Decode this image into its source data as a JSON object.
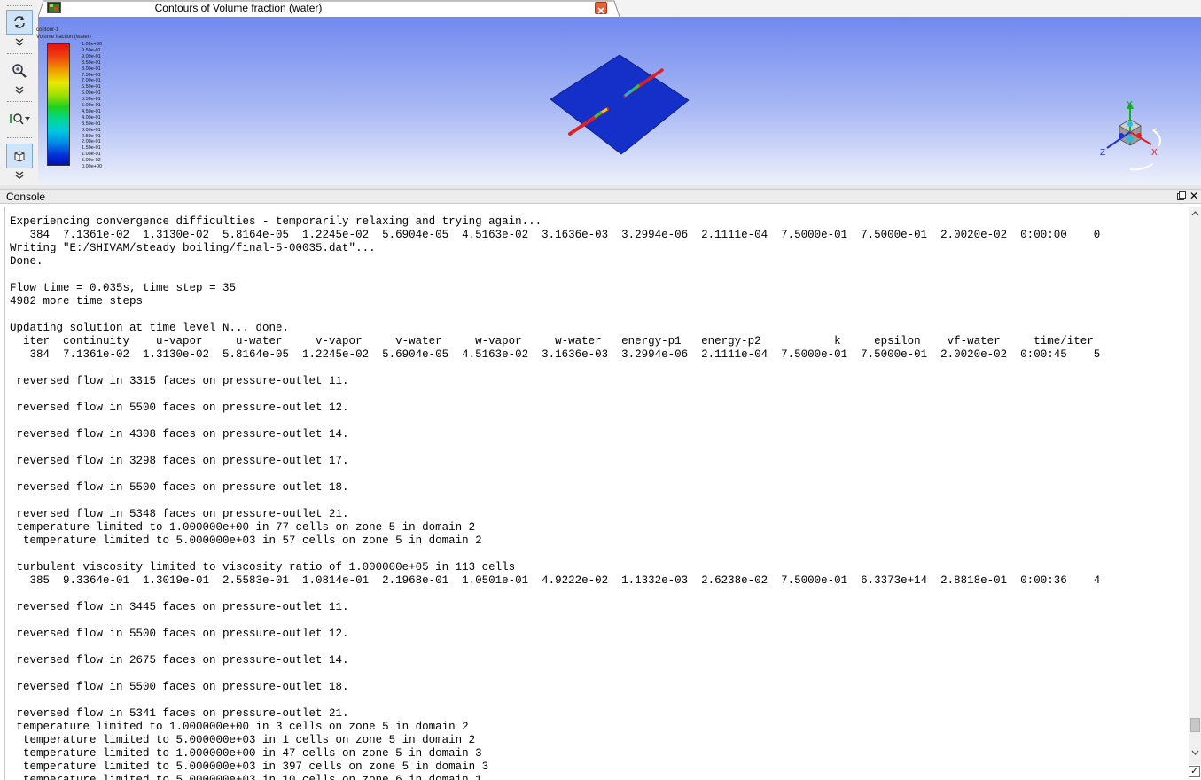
{
  "window": {
    "tab_title": "Contours of Volume fraction (water)"
  },
  "toolbar": {
    "icons": [
      "rotate-icon",
      "zoom-icon",
      "view-probe-icon",
      "cube-view-icon"
    ]
  },
  "legend": {
    "title1": "contour-1",
    "title2": "Volume fraction (water)",
    "labels": [
      "1.00e+00",
      "9.50e-01",
      "9.00e-01",
      "8.50e-01",
      "8.00e-01",
      "7.50e-01",
      "7.00e-01",
      "6.50e-01",
      "6.00e-01",
      "5.50e-01",
      "5.00e-01",
      "4.50e-01",
      "4.00e-01",
      "3.50e-01",
      "3.00e-01",
      "2.50e-01",
      "2.00e-01",
      "1.50e-01",
      "1.00e-01",
      "5.00e-02",
      "0.00e+00"
    ]
  },
  "axes_triad": {
    "x": "X",
    "y": "Y",
    "z": "Z"
  },
  "colors": {
    "domain_face": "#1530c8",
    "viewport_top": "#7189ef",
    "accent_red": "#e02020"
  },
  "console": {
    "title": "Console",
    "lines": [
      "Experiencing convergence difficulties - temporarily relaxing and trying again...",
      "   384  7.1361e-02  1.3130e-02  5.8164e-05  1.2245e-02  5.6904e-05  4.5163e-02  3.1636e-03  3.2994e-06  2.1111e-04  7.5000e-01  7.5000e-01  2.0020e-02  0:00:00    0",
      "Writing \"E:/SHIVAM/steady boiling/final-5-00035.dat\"...",
      "Done.",
      "",
      "Flow time = 0.035s, time step = 35",
      "4982 more time steps",
      "",
      "Updating solution at time level N... done.",
      "  iter  continuity    u-vapor     u-water     v-vapor     v-water     w-vapor     w-water   energy-p1   energy-p2           k     epsilon    vf-water     time/iter",
      "   384  7.1361e-02  1.3130e-02  5.8164e-05  1.2245e-02  5.6904e-05  4.5163e-02  3.1636e-03  3.2994e-06  2.1111e-04  7.5000e-01  7.5000e-01  2.0020e-02  0:00:45    5",
      "",
      " reversed flow in 3315 faces on pressure-outlet 11.",
      "",
      " reversed flow in 5500 faces on pressure-outlet 12.",
      "",
      " reversed flow in 4308 faces on pressure-outlet 14.",
      "",
      " reversed flow in 3298 faces on pressure-outlet 17.",
      "",
      " reversed flow in 5500 faces on pressure-outlet 18.",
      "",
      " reversed flow in 5348 faces on pressure-outlet 21.",
      " temperature limited to 1.000000e+00 in 77 cells on zone 5 in domain 2",
      "  temperature limited to 5.000000e+03 in 57 cells on zone 5 in domain 2",
      "",
      " turbulent viscosity limited to viscosity ratio of 1.000000e+05 in 113 cells",
      "   385  9.3364e-01  1.3019e-01  2.5583e-01  1.0814e-01  2.1968e-01  1.0501e-01  4.9222e-02  1.1332e-03  2.6238e-02  7.5000e-01  6.3373e+14  2.8818e-01  0:00:36    4",
      "",
      " reversed flow in 3445 faces on pressure-outlet 11.",
      "",
      " reversed flow in 5500 faces on pressure-outlet 12.",
      "",
      " reversed flow in 2675 faces on pressure-outlet 14.",
      "",
      " reversed flow in 5500 faces on pressure-outlet 18.",
      "",
      " reversed flow in 5341 faces on pressure-outlet 21.",
      " temperature limited to 1.000000e+00 in 3 cells on zone 5 in domain 2",
      "  temperature limited to 5.000000e+03 in 1 cells on zone 5 in domain 2",
      "  temperature limited to 1.000000e+00 in 47 cells on zone 5 in domain 3",
      "  temperature limited to 5.000000e+03 in 397 cells on zone 5 in domain 3",
      "  temperature limited to 5.000000e+03 in 10 cells on zone 6 in domain 1"
    ]
  }
}
